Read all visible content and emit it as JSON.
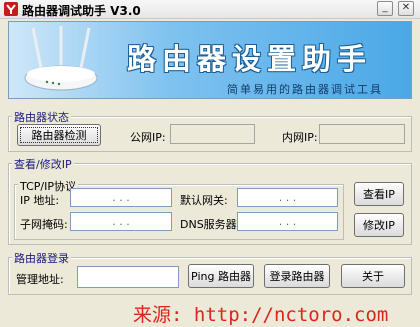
{
  "window": {
    "title": "路由器调试助手 V3.0",
    "minimize": "_",
    "close": "✕"
  },
  "banner": {
    "title": "路由器设置助手",
    "subtitle": "简单易用的路由器调试工具"
  },
  "status_group": {
    "label": "路由器状态",
    "detect_button": "路由器检测",
    "public_ip_label": "公网IP:",
    "public_ip_value": "",
    "lan_ip_label": "内网IP:",
    "lan_ip_value": ""
  },
  "ip_group": {
    "label": "查看/修改IP",
    "tcp_label": "TCP/IP协议",
    "ip_label": "IP  地址:",
    "mask_label": "子网掩码:",
    "gateway_label": "默认网关:",
    "dns_label": "DNS服务器:",
    "ip_dots": ". . .",
    "view_button": "查看IP",
    "modify_button": "修改IP"
  },
  "login_group": {
    "label": "路由器登录",
    "address_label": "管理地址:",
    "address_value": "",
    "ping_button": "Ping 路由器",
    "login_button": "登录路由器",
    "about_button": "关于"
  },
  "footer": {
    "text": "来源: http://nctoro.com"
  },
  "colors": {
    "accent": "#4aa8e6",
    "footer": "#d9261c",
    "group_label": "#1a1a80"
  },
  "icons": {
    "app": "app-logo-icon",
    "banner": "router-icon"
  }
}
